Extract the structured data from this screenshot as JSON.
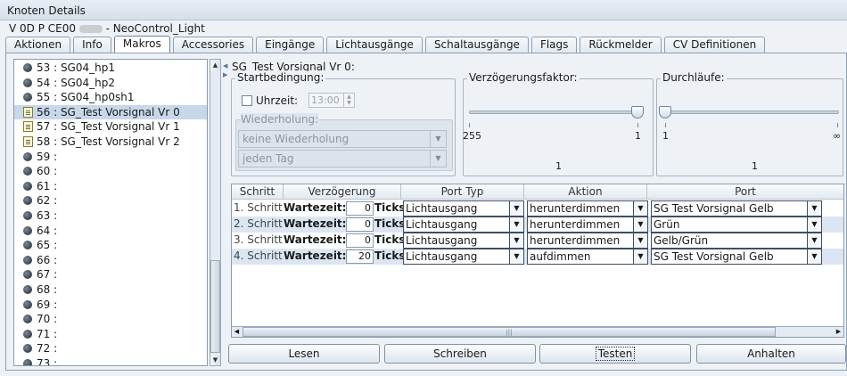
{
  "window": {
    "title": "Knoten Details",
    "node_prefix": "V 0D P CE00",
    "node_name": "- NeoControl_Light"
  },
  "tabs": [
    "Aktionen",
    "Info",
    "Makros",
    "Accessories",
    "Eingänge",
    "Lichtausgänge",
    "Schaltausgänge",
    "Flags",
    "Rückmelder",
    "CV Definitionen"
  ],
  "active_tab": "Makros",
  "macros": [
    {
      "label": "53 : SG04_hp1",
      "icon": "bullet-icon"
    },
    {
      "label": "54 : SG04_hp2",
      "icon": "bullet-icon"
    },
    {
      "label": "55 : SG04_hp0sh1",
      "icon": "bullet-icon"
    },
    {
      "label": "56 : SG_Test Vorsignal Vr 0",
      "icon": "document-icon",
      "selected": true
    },
    {
      "label": "57 : SG_Test Vorsignal Vr 1",
      "icon": "document-icon"
    },
    {
      "label": "58 : SG_Test Vorsignal Vr 2",
      "icon": "document-icon"
    },
    {
      "label": "59 :",
      "icon": "bullet-icon"
    },
    {
      "label": "60 :",
      "icon": "bullet-icon"
    },
    {
      "label": "61 :",
      "icon": "bullet-icon"
    },
    {
      "label": "62 :",
      "icon": "bullet-icon"
    },
    {
      "label": "63 :",
      "icon": "bullet-icon"
    },
    {
      "label": "64 :",
      "icon": "bullet-icon"
    },
    {
      "label": "65 :",
      "icon": "bullet-icon"
    },
    {
      "label": "66 :",
      "icon": "bullet-icon"
    },
    {
      "label": "67 :",
      "icon": "bullet-icon"
    },
    {
      "label": "68 :",
      "icon": "bullet-icon"
    },
    {
      "label": "69 :",
      "icon": "bullet-icon"
    },
    {
      "label": "70 :",
      "icon": "bullet-icon"
    },
    {
      "label": "71 :",
      "icon": "bullet-icon"
    },
    {
      "label": "72 :",
      "icon": "bullet-icon"
    },
    {
      "label": "73 :",
      "icon": "bullet-icon"
    }
  ],
  "macro_panel": {
    "title": "SG_Test Vorsignal Vr 0:",
    "start": {
      "label": "Startbedingung:",
      "time_label": "Uhrzeit:",
      "time_value": "13:00",
      "repeat_label": "Wiederholung:",
      "repeat_value": "keine Wiederholung",
      "day_value": "jeden Tag"
    },
    "delay": {
      "label": "Verzögerungsfaktor:",
      "min_label": "255",
      "max_label": "1",
      "value": "1"
    },
    "runs": {
      "label": "Durchläufe:",
      "min_label": "1",
      "max_label": "∞",
      "value": "1"
    }
  },
  "steps_table": {
    "headers": [
      "Schritt",
      "Verzögerung",
      "Port Typ",
      "Aktion",
      "Port"
    ],
    "wait_label": "Wartezeit:",
    "unit": "Ticks",
    "rows": [
      {
        "step": "1. Schritt",
        "delay": "0",
        "port_type": "Lichtausgang",
        "action": "herunterdimmen",
        "port": "SG Test Vorsignal Gelb"
      },
      {
        "step": "2. Schritt",
        "delay": "0",
        "port_type": "Lichtausgang",
        "action": "herunterdimmen",
        "port": "Grün"
      },
      {
        "step": "3. Schritt",
        "delay": "0",
        "port_type": "Lichtausgang",
        "action": "herunterdimmen",
        "port": "Gelb/Grün"
      },
      {
        "step": "4. Schritt",
        "delay": "20",
        "port_type": "Lichtausgang",
        "action": "aufdimmen",
        "port": "SG Test Vorsignal Gelb"
      }
    ]
  },
  "buttons": {
    "read": "Lesen",
    "write": "Schreiben",
    "test": "Testen",
    "stop": "Anhalten"
  }
}
